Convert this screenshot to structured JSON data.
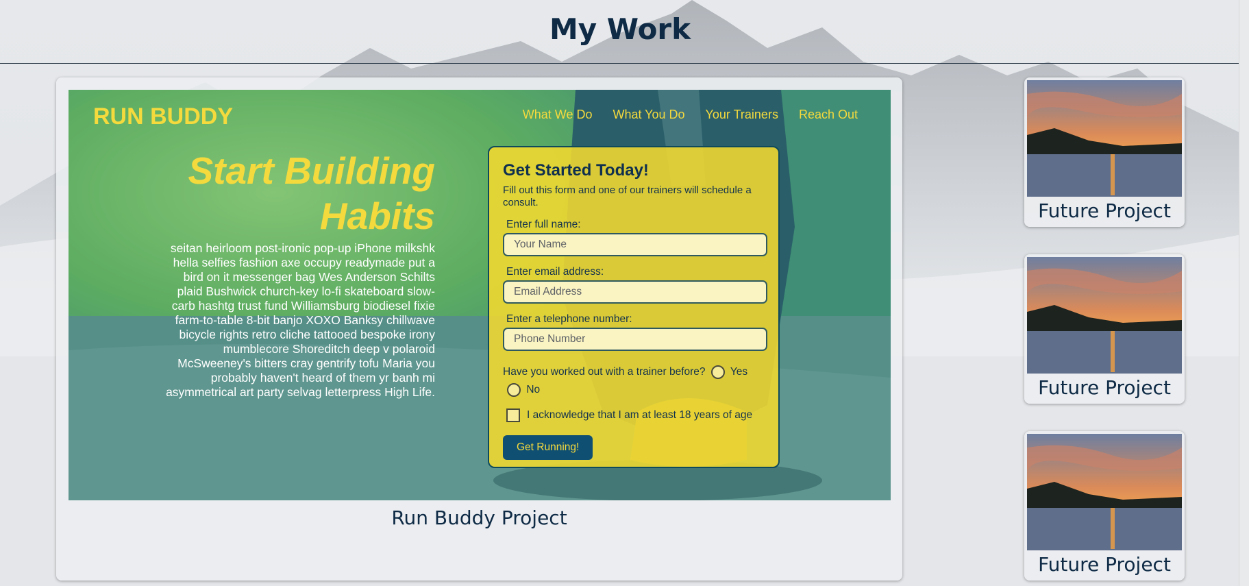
{
  "page": {
    "title": "My Work"
  },
  "main_project": {
    "caption": "Run Buddy Project",
    "preview": {
      "brand": "RUN BUDDY",
      "nav": [
        "What We Do",
        "What You Do",
        "Your Trainers",
        "Reach Out"
      ],
      "hero_title": "Start Building Habits",
      "hero_text": "seitan heirloom post-ironic pop-up iPhone milkshk hella selfies fashion axe occupy readymade put a bird on it messenger bag Wes Anderson Schilts plaid Bushwick church-key lo-fi skateboard slow-carb hashtg trust fund Williamsburg biodiesel fixie farm-to-table 8-bit banjo XOXO Banksy chillwave bicycle rights retro cliche tattooed bespoke irony mumblecore Shoreditch deep v polaroid McSweeney's bitters cray gentrify tofu Maria you probably haven't heard of them yr banh mi asymmetrical art party selvag letterpress High Life.",
      "form": {
        "heading": "Get Started Today!",
        "subheading": "Fill out this form and one of our trainers will schedule a consult.",
        "name_label": "Enter full name:",
        "name_placeholder": "Your Name",
        "email_label": "Enter email address:",
        "email_placeholder": "Email Address",
        "phone_label": "Enter a telephone number:",
        "phone_placeholder": "Phone Number",
        "trainer_question": "Have you worked out with a trainer before?",
        "yes_label": "Yes",
        "no_label": "No",
        "age_ack": "I acknowledge that I am at least 18 years of age",
        "submit_label": "Get Running!"
      }
    }
  },
  "future_projects": [
    {
      "caption": "Future Project"
    },
    {
      "caption": "Future Project"
    },
    {
      "caption": "Future Project"
    }
  ],
  "colors": {
    "heading_navy": "#0e2a45",
    "accent_yellow": "#f5da3d",
    "button_blue": "#0f4f72"
  }
}
